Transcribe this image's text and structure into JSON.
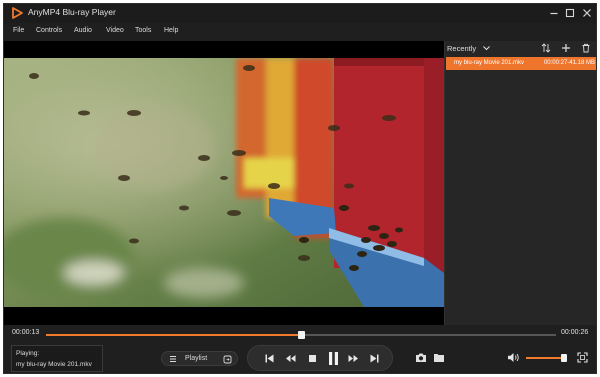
{
  "window": {
    "title": "AnyMP4 Blu-ray Player"
  },
  "menu": [
    "File",
    "Controls",
    "Audio",
    "Video",
    "Tools",
    "Help"
  ],
  "playlist_panel": {
    "filter_label": "Recently",
    "items": [
      {
        "name": "my blu-ray Movie 201.mkv",
        "meta": "00:00:27-41.18 MB",
        "selected": true
      }
    ]
  },
  "playback": {
    "current_time": "00:00:13",
    "total_time": "00:00:26",
    "progress": 0.5
  },
  "now_playing": {
    "label": "Playing:",
    "file": "my blu-ray Movie 201.mkv"
  },
  "playlist_button": {
    "label": "Playlist"
  },
  "volume": {
    "level": 0.95
  },
  "icons": {
    "title": [
      "app-logo-icon",
      "minimize-icon",
      "maximize-icon",
      "close-icon"
    ],
    "panel": [
      "chevron-down-icon",
      "sort-icon",
      "add-icon",
      "trash-icon"
    ],
    "transport": [
      "skip-previous-icon",
      "rewind-icon",
      "stop-icon",
      "pause-icon",
      "fast-forward-icon",
      "skip-next-icon"
    ],
    "side": [
      "snapshot-icon",
      "open-folder-icon",
      "volume-icon",
      "fullscreen-icon",
      "playlist-icon",
      "loop-icon"
    ]
  },
  "colors": {
    "accent": "#f07a2d",
    "background": "#1f1f1f",
    "selected_item": "#f0752c"
  }
}
